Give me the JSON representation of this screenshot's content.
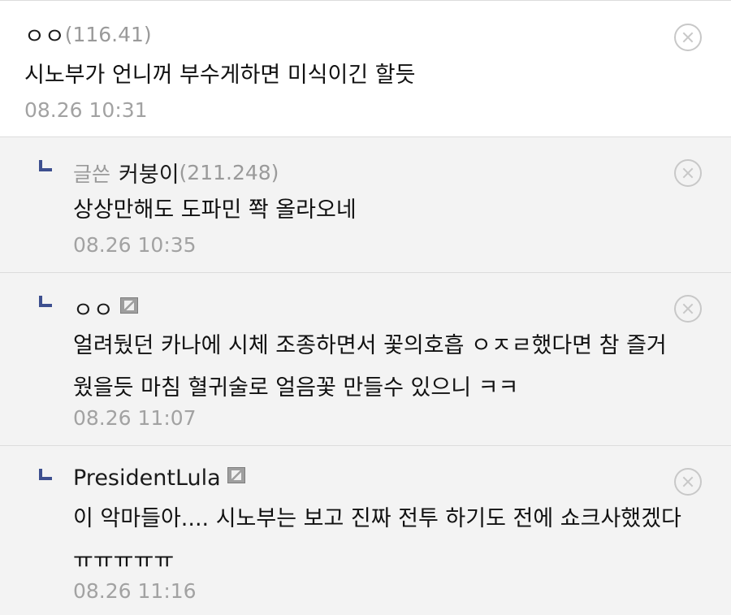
{
  "comments": [
    {
      "prefix": "",
      "nickname": "ㅇㅇ",
      "ip": "(116.41)",
      "text": [
        "시노부가 언니꺼 부수게하면 미식이긴 할듯"
      ],
      "time": "08.26 10:31"
    },
    {
      "prefix": "글쓴",
      "nickname": "커붕이",
      "ip": "(211.248)",
      "text": [
        "상상만해도 도파민 쫙 올라오네"
      ],
      "time": "08.26 10:35"
    },
    {
      "prefix": "",
      "nickname": "ㅇㅇ",
      "ip": "",
      "text": [
        "얼려뒀던 카나에 시체 조종하면서 꽃의호흡 ㅇㅈㄹ했다면 참 즐거",
        "웠을듯 마침 혈귀술로 얼음꽃 만들수 있으니 ㅋㅋ"
      ],
      "time": "08.26 11:07"
    },
    {
      "prefix": "",
      "nickname": "PresidentLula",
      "ip": "",
      "text": [
        "이 악마들아.... 시노부는 보고 진짜 전투 하기도 전에 쇼크사했겠다",
        "ㅠㅠㅠㅠㅠ"
      ],
      "time": "08.26 11:16"
    }
  ],
  "icons": {
    "reply": "reply-arrow-icon",
    "delete": "close-circle-icon",
    "member_badge": "fixed-nickname-icon"
  },
  "colors": {
    "reply_marker": "#3d4f8f",
    "timestamp": "#a2a2a2",
    "ip": "#9a9a9a"
  }
}
